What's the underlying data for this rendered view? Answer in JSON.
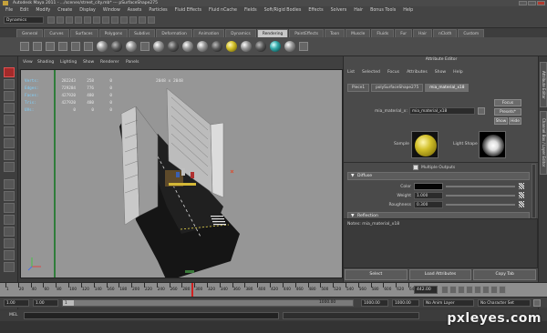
{
  "titlebar": {
    "title": "Autodesk Maya 2011 - .../scenes/street_city.mb* --- pSurfaceShape275"
  },
  "menubar": {
    "items": [
      "File",
      "Edit",
      "Modify",
      "Create",
      "Display",
      "Window",
      "Assets",
      "Particles",
      "Fluid Effects",
      "Fluid nCache",
      "Fields",
      "Soft/Rigid Bodies",
      "Effects",
      "Solvers",
      "Hair",
      "Bonus Tools",
      "Help"
    ]
  },
  "status_line": {
    "mode": "Dynamics"
  },
  "shelf_tabs": {
    "items": [
      "General",
      "Curves",
      "Surfaces",
      "Polygons",
      "Subdivs",
      "Deformation",
      "Animation",
      "Dynamics",
      "Rendering",
      "PaintEffects",
      "Toon",
      "Muscle",
      "Fluids",
      "Fur",
      "Hair",
      "nCloth",
      "Custom"
    ],
    "active": "Rendering"
  },
  "viewport_menu": {
    "items": [
      "View",
      "Shading",
      "Lighting",
      "Show",
      "Renderer",
      "Panels"
    ]
  },
  "hud": {
    "rows": [
      {
        "label": "Verts:",
        "a": "282243",
        "b": "258",
        "c": "0"
      },
      {
        "label": "Edges:",
        "a": "729284",
        "b": "776",
        "c": "0"
      },
      {
        "label": "Faces:",
        "a": "427920",
        "b": "480",
        "c": "0"
      },
      {
        "label": "Tris:",
        "a": "427920",
        "b": "480",
        "c": "0"
      },
      {
        "label": "UVs:",
        "a": "0",
        "b": "0",
        "c": "0"
      }
    ],
    "resolution": "2048 x 2048"
  },
  "attribute_editor": {
    "header": "Attribute Editor",
    "menu": [
      "List",
      "Selected",
      "Focus",
      "Attributes",
      "Show",
      "Help"
    ],
    "tabs": [
      "Piece1",
      "polySurfaceShape275",
      "mia_material_x18"
    ],
    "active_tab": "mia_material_x18",
    "name_label": "mia_material_x:",
    "name_value": "mia_material_x18",
    "focus_btn": "Focus",
    "presets_btn": "Presets*",
    "show_btn": "Show",
    "hide_btn": "Hide",
    "sample_label": "Sample",
    "light_shape_label": "Light Shape",
    "multiple_outputs_label": "Multiple Outputs",
    "diffuse_section": "Diffuse",
    "color_label": "Color",
    "weight_label": "Weight",
    "weight_value": "1.000",
    "roughness_label": "Roughness",
    "roughness_value": "0.300",
    "reflection_section": "Reflection",
    "notes_label": "Notes:  mia_material_x18",
    "select_btn": "Select",
    "load_attributes_btn": "Load Attributes",
    "copy_tab_btn": "Copy Tab"
  },
  "right_strip": {
    "tabs": [
      "Attribute Editor",
      "Channel Box / Layer Editor"
    ]
  },
  "timeline": {
    "ticks": [
      "1",
      "20",
      "40",
      "60",
      "80",
      "100",
      "120",
      "140",
      "160",
      "180",
      "200",
      "220",
      "240",
      "260",
      "280",
      "300",
      "320",
      "340",
      "360",
      "380",
      "400",
      "420",
      "440",
      "460",
      "480",
      "500",
      "520",
      "540",
      "560",
      "580",
      "600",
      "620",
      "640"
    ],
    "current_frame": "442.00"
  },
  "range": {
    "start": "1.00",
    "inner_start": "1.00",
    "marker": "1",
    "inner_end": "1000.00",
    "end_a": "1000.00",
    "end_b": "1000.00",
    "anim_layer": "No Anim Layer",
    "char_set": "No Character Set"
  },
  "command_line": {
    "label": "MEL"
  },
  "watermark": "pxleyes.com",
  "colors": {
    "selected_tool": "#a32a2a",
    "sample_sphere": "#d2c02a",
    "viewport_bg": "#969696"
  }
}
